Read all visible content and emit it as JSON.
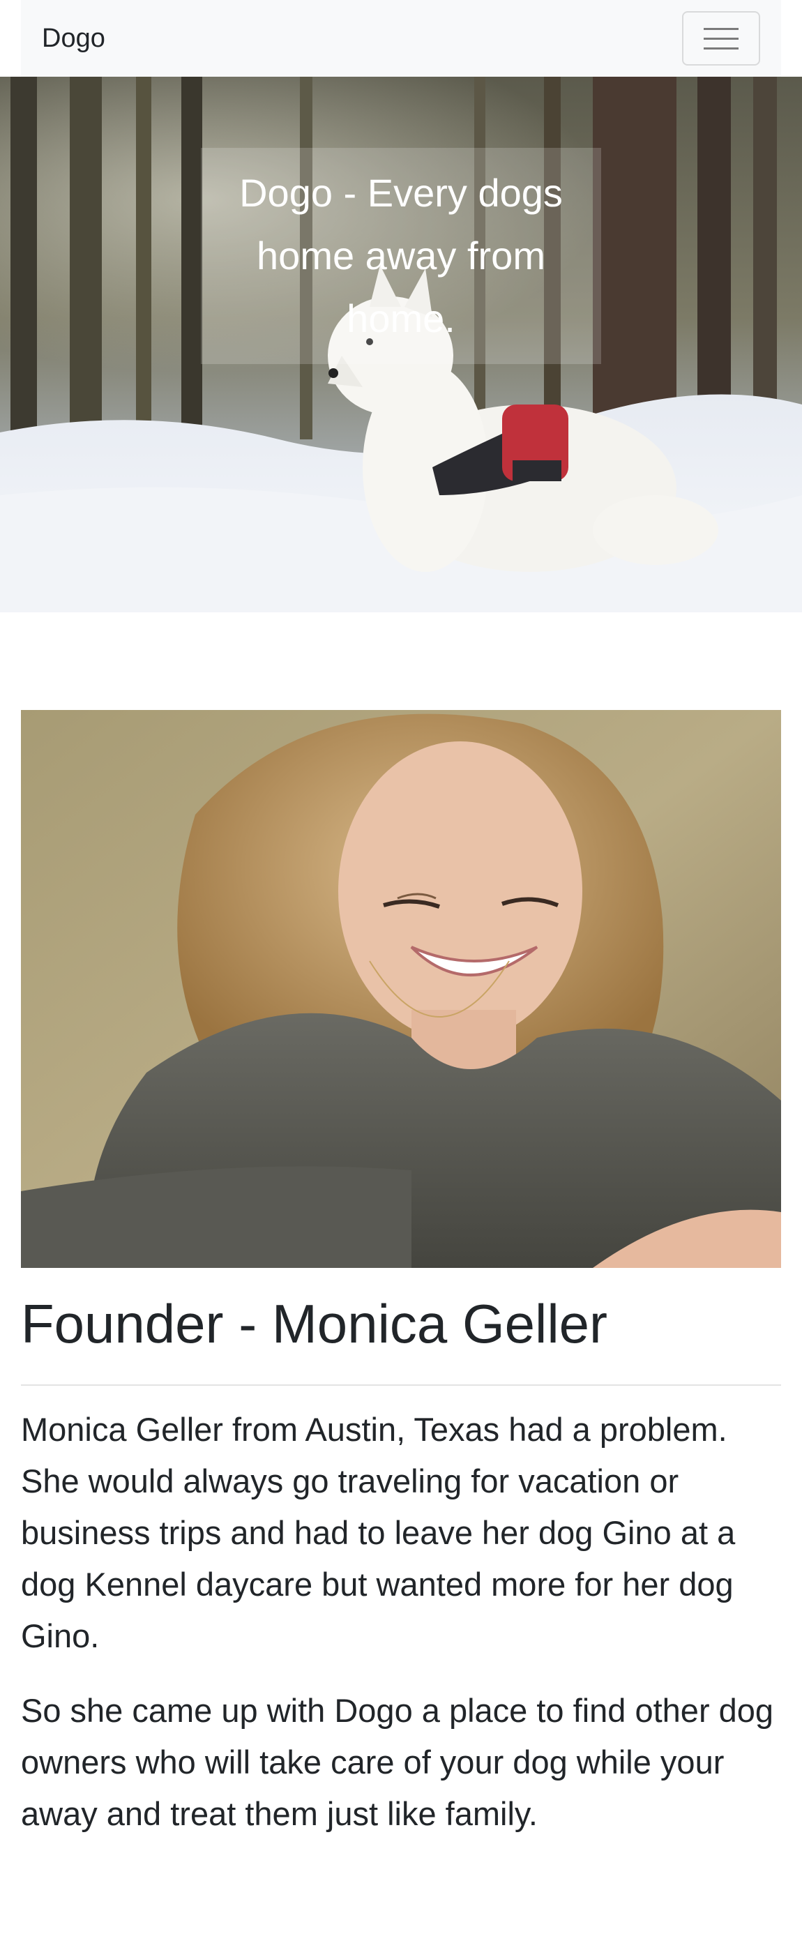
{
  "navbar": {
    "brand": "Dogo",
    "toggle_icon": "hamburger-menu-icon"
  },
  "hero": {
    "caption": "Dogo - Every dogs home away from home.",
    "image_subject": "white dog in snowy forest"
  },
  "founder": {
    "image_subject": "smiling woman with long blonde hair",
    "title": "Founder - Monica Geller",
    "paragraphs": [
      "Monica Geller from Austin, Texas had a problem. She would always go traveling for vacation or business trips and had to leave her dog Gino at a dog Kennel daycare but wanted more for her dog Gino.",
      "So she came up with Dogo a place to find other dog owners who will take care of your dog while your away and treat them just like family."
    ]
  },
  "colors": {
    "navbar_bg": "#f8f9fa",
    "text": "#212529",
    "hero_caption_text": "#ffffff"
  }
}
